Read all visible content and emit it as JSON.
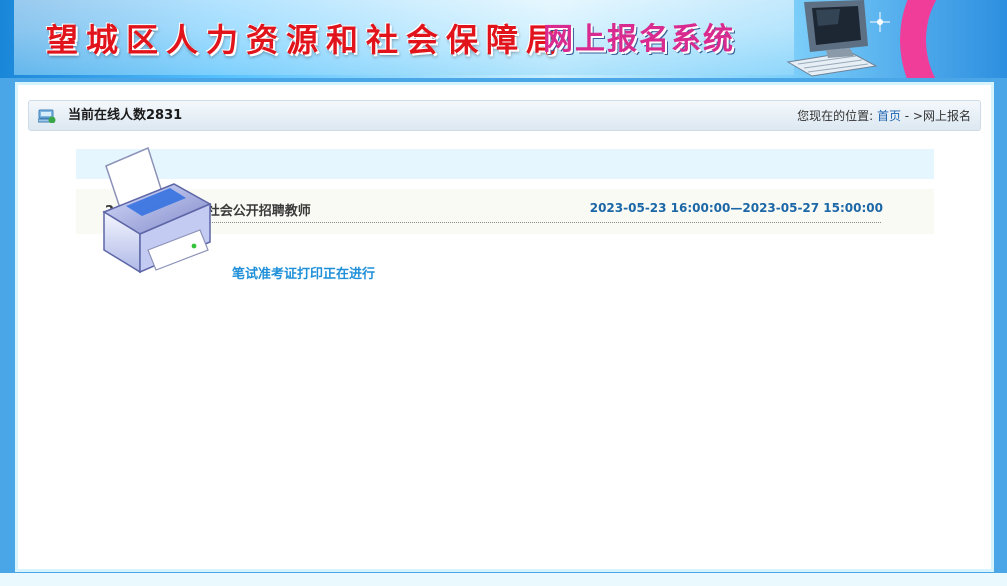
{
  "header": {
    "org_title": "望城区人力资源和社会保障局",
    "system_title": "网上报名系统",
    "colors": {
      "org_title": "#e1131b",
      "system_title": "#d92b8f",
      "accent_arc": "#f03d9a"
    },
    "icons": [
      "computer-icon"
    ]
  },
  "infobar": {
    "online_label": "当前在线人数",
    "online_count": "2831",
    "location_label": "您现在的位置:",
    "home_link": "首页",
    "separator": " - >",
    "current_page": "网上报名",
    "icons": [
      "online-users-icon"
    ]
  },
  "notice": {
    "title_visible": "2 区2023年面向社会公开招聘教师",
    "time_range": "2023-05-23 16:00:00—2023-05-27 15:00:00",
    "action_link": "笔试准考证打印正在进行",
    "icons": [
      "printer-icon"
    ],
    "colors": {
      "time": "#1b67a7",
      "action": "#1e8fd8"
    }
  }
}
